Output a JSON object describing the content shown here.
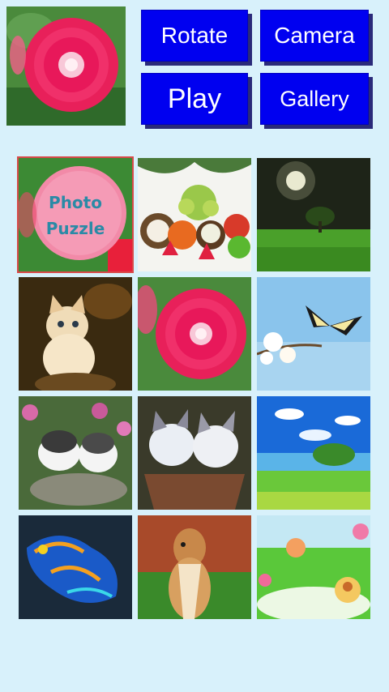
{
  "buttons": {
    "rotate": "Rotate",
    "camera": "Camera",
    "play": "Play",
    "gallery": "Gallery"
  },
  "logo": {
    "line1": "Photo",
    "line2": "Puzzle"
  },
  "gallery_items": [
    "photo-puzzle-logo",
    "fruit-bowl",
    "night-tree-field",
    "kitten",
    "red-flower",
    "butterfly-blossom",
    "two-kittens-flowers",
    "two-kittens-basket",
    "lake-landscape",
    "mandarin-fish",
    "chipmunk",
    "cartoon-garden"
  ],
  "colors": {
    "background": "#d8f1fb",
    "button": "#0000f0",
    "button_shadow": "#2a2a7a",
    "button_text": "#ffffff"
  }
}
